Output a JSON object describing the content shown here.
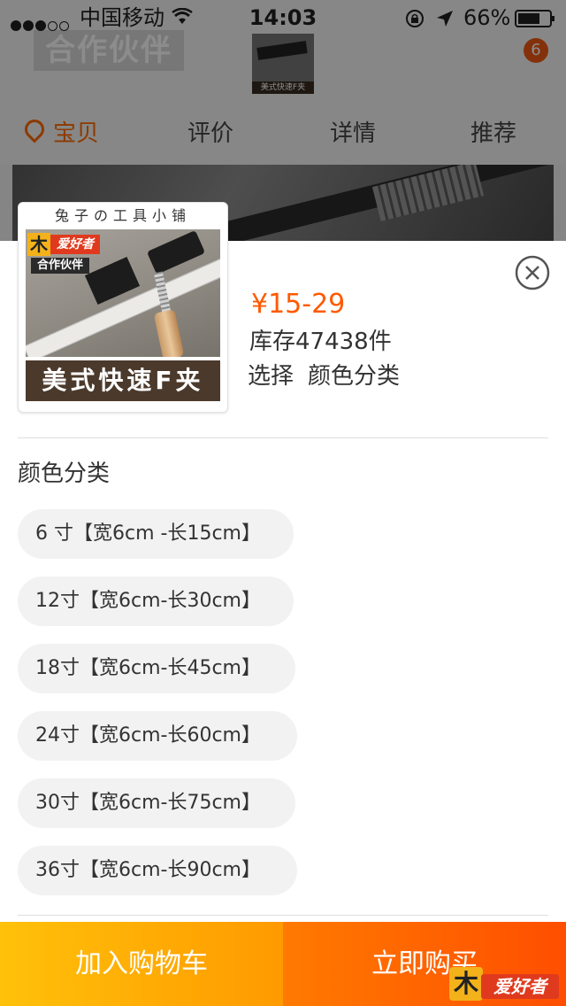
{
  "status_bar": {
    "carrier": "中国移动",
    "time": "14:03",
    "battery": "66%"
  },
  "background_page": {
    "partner_text": "合作伙伴",
    "thumb_label": "美式快速F夹",
    "badge": "6",
    "tabs": [
      "宝贝",
      "评价",
      "详情",
      "推荐"
    ]
  },
  "product": {
    "shop_name": "兔子の工具小铺",
    "logo_text": "爱好者",
    "logo_char": "木",
    "partner_text": "合作伙伴",
    "caption": "美式快速F夹",
    "price": "¥15-29",
    "stock": "库存47438件",
    "select_label": "选择",
    "select_value": "颜色分类"
  },
  "sku": {
    "section_title": "颜色分类",
    "options": [
      "6 寸【宽6cm -长15cm】",
      "12寸【宽6cm-长30cm】",
      "18寸【宽6cm-长45cm】",
      "24寸【宽6cm-长60cm】",
      "30寸【宽6cm-长75cm】",
      "36寸【宽6cm-长90cm】"
    ]
  },
  "actions": {
    "add_to_cart": "加入购物车",
    "buy_now": "立即购买"
  },
  "watermark": {
    "char": "木",
    "text": "爱好者"
  },
  "colors": {
    "accent": "#ff5a00",
    "cart_button": "#ffa400",
    "buy_button": "#ff5e00",
    "option_bg": "#f2f2f2"
  }
}
